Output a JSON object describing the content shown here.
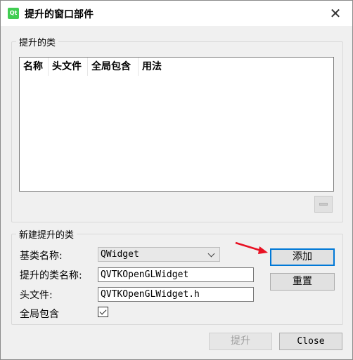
{
  "window": {
    "title": "提升的窗口部件",
    "app_icon_text": "Qt"
  },
  "promoted_group": {
    "title": "提升的类",
    "columns": [
      "名称",
      "头文件",
      "全局包含",
      "用法"
    ]
  },
  "new_group": {
    "title": "新建提升的类",
    "base_class_label": "基类名称:",
    "base_class_value": "QWidget",
    "promoted_class_label": "提升的类名称:",
    "promoted_class_value": "QVTKOpenGLWidget",
    "header_label": "头文件:",
    "header_value": "QVTKOpenGLWidget.h",
    "global_include_label": "全局包含",
    "global_include_checked": true,
    "add_label": "添加",
    "reset_label": "重置"
  },
  "footer": {
    "promote_label": "提升",
    "close_label": "Close"
  },
  "colors": {
    "accent": "#0078d7",
    "arrow": "#e81123",
    "qt_green": "#41cd52"
  }
}
